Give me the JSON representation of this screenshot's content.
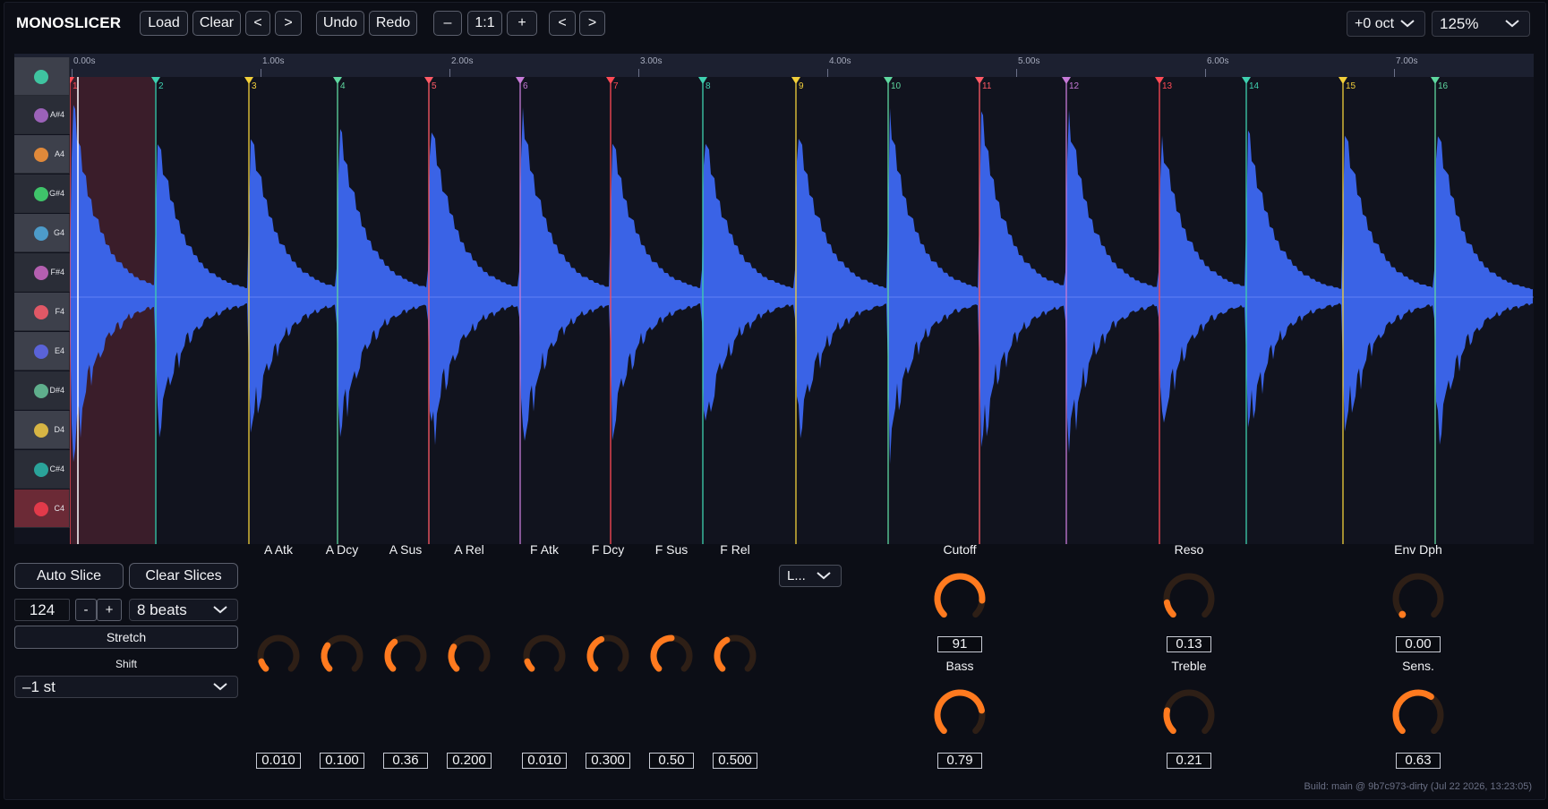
{
  "app": {
    "title": "MONOSLICER"
  },
  "toolbar": {
    "load": "Load",
    "clear": "Clear",
    "prev": "<",
    "next": ">",
    "undo": "Undo",
    "redo": "Redo",
    "zoom_out": "–",
    "zoom_reset": "1:1",
    "zoom_in": "+",
    "nav_prev": "<",
    "nav_next": ">",
    "octave": "+0 oct",
    "zoom_level": "125%"
  },
  "timeline": {
    "labels": [
      "0.00s",
      "1.00s",
      "2.00s",
      "3.00s",
      "4.00s",
      "5.00s",
      "6.00s",
      "7.00s"
    ]
  },
  "keys": [
    {
      "note": "A#4",
      "color": "#9b62b8"
    },
    {
      "note": "A4",
      "color": "#e0893a"
    },
    {
      "note": "G#4",
      "color": "#3fc46a"
    },
    {
      "note": "G4",
      "color": "#4d9bc9"
    },
    {
      "note": "F#4",
      "color": "#b45fb0"
    },
    {
      "note": "F4",
      "color": "#e05866"
    },
    {
      "note": "E4",
      "color": "#5a63d8"
    },
    {
      "note": "D#4",
      "color": "#5fae8c"
    },
    {
      "note": "D4",
      "color": "#d7b544"
    },
    {
      "note": "C#4",
      "color": "#2aa39a"
    },
    {
      "note": "C4",
      "color": "#e23a4a"
    }
  ],
  "slices": [
    {
      "n": "1",
      "color": "#ff4a55"
    },
    {
      "n": "2",
      "color": "#3fd0b0"
    },
    {
      "n": "3",
      "color": "#f2cf3a"
    },
    {
      "n": "4",
      "color": "#5fd8a0"
    },
    {
      "n": "5",
      "color": "#ff5a66"
    },
    {
      "n": "6",
      "color": "#c77ad8"
    },
    {
      "n": "7",
      "color": "#ff4a55"
    },
    {
      "n": "8",
      "color": "#3fd0b0"
    },
    {
      "n": "9",
      "color": "#f2cf3a"
    },
    {
      "n": "10",
      "color": "#5fd8a0"
    },
    {
      "n": "11",
      "color": "#ff5a66"
    },
    {
      "n": "12",
      "color": "#c77ad8"
    },
    {
      "n": "13",
      "color": "#ff4a55"
    },
    {
      "n": "14",
      "color": "#3fd0b0"
    },
    {
      "n": "15",
      "color": "#f2cf3a"
    },
    {
      "n": "16",
      "color": "#5fd8a0"
    }
  ],
  "slicing": {
    "auto_slice": "Auto Slice",
    "clear_slices": "Clear Slices",
    "bpm": "124",
    "bpm_minus": "-",
    "bpm_plus": "+",
    "beats": "8 beats",
    "stretch": "Stretch",
    "shift_label": "Shift",
    "shift_value": "–1 st"
  },
  "envelope": [
    {
      "label": "A Atk",
      "value": "0.010",
      "level": 0.1
    },
    {
      "label": "A Dcy",
      "value": "0.100",
      "level": 0.3
    },
    {
      "label": "A Sus",
      "value": "0.36",
      "level": 0.36
    },
    {
      "label": "A Rel",
      "value": "0.200",
      "level": 0.28
    },
    {
      "label": "F Atk",
      "value": "0.010",
      "level": 0.1
    },
    {
      "label": "F Dcy",
      "value": "0.300",
      "level": 0.42
    },
    {
      "label": "F Sus",
      "value": "0.50",
      "level": 0.5
    },
    {
      "label": "F Rel",
      "value": "0.500",
      "level": 0.4
    }
  ],
  "filter_type": "L...",
  "filter": [
    {
      "label": "Cutoff",
      "value": "91",
      "level": 0.85
    },
    {
      "label": "Reso",
      "value": "0.13",
      "level": 0.13
    },
    {
      "label": "Env Dph",
      "value": "0.00",
      "level": 0.0
    },
    {
      "label": "Bass",
      "value": "0.79",
      "level": 0.79
    },
    {
      "label": "Treble",
      "value": "0.21",
      "level": 0.21
    },
    {
      "label": "Sens.",
      "value": "0.63",
      "level": 0.63
    }
  ],
  "colors": {
    "accent": "#ff7a1f",
    "waveform": "#3a63e6"
  },
  "build": "Build: main @ 9b7c973-dirty (Jul 22 2026, 13:23:05)"
}
